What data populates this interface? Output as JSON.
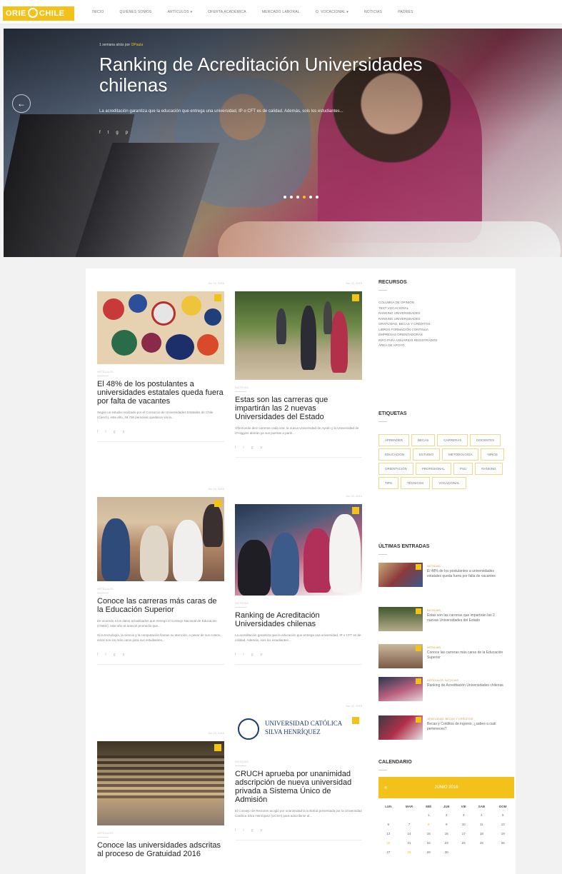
{
  "brand": {
    "logo_left": "ORIE",
    "logo_right": "CHILE",
    "accent": "#f3c21a"
  },
  "menu": [
    "INICIO",
    "QUIÉNES SOMOS",
    "ARTÍCULOS ▾",
    "OFERTA ACADÉMICA",
    "MERCADO LABORAL",
    "O. VOCACIONAL ▾",
    "NOTICIAS",
    "PADRES"
  ],
  "hero": {
    "kicker": "1 semana atrás por",
    "kicker_link": "OPaula",
    "title": "Ranking de Acreditación Universidades chilenas",
    "description": "La acreditación garantiza que la educación que entrega una universidad, IP o CFT es de calidad. Además, sois los estudiantes...",
    "share": [
      "f",
      "t",
      "g",
      "p"
    ],
    "arrow": "←"
  },
  "posts": [
    {
      "date": "Jun 22, 2016",
      "category": "ARTÍCULOS",
      "title": "El 48% de los postulantes a universidades estatales queda fuera por falta de vacantes",
      "excerpt": "Según un estudio realizado por el Consorcio de Universidades Estatales de Chile (Cuech), este año, 48.756 personas quedaron sin la...",
      "share": [
        "f",
        "t",
        "g",
        "p"
      ]
    },
    {
      "date": "Jun 22, 2016",
      "category": "NOTICIAS",
      "title": "Estas son las carreras que impartirán las 2 nuevas Universidades del Estado",
      "excerpt": "Oferecerán diez carreras cada una: la nueva Universidad de Aysén y la Universidad de O'Higgins abrirán ya sus puertas a partir...",
      "share": [
        "f",
        "t",
        "g",
        "p"
      ]
    },
    {
      "date": "Jun 22, 2016",
      "category": "ARTÍCULOS",
      "title": "Conoce las carreras más caras de la Educación Superior",
      "excerpt": "De acuerdo a los datos actualizados que entregó el Consejo Nacional de Educación (CNED), este año el arancel promedio que...",
      "excerpt2": "Si la tecnología, la ciencia y la computación llaman su atención, a pesar de sus costos, estos son los más caros para sus estudiantes...",
      "share": [
        "f",
        "t",
        "g",
        "p"
      ]
    },
    {
      "date": "Jun 22, 2016",
      "category": "NOTICIAS",
      "title": "Ranking de Acreditación Universidades chilenas",
      "excerpt": "La acreditación garantiza que la educación que entrega una universidad, IP o CFT es de calidad. Además, sois los estudiantes...",
      "share": [
        "f",
        "t",
        "g",
        "p"
      ]
    },
    {
      "date": "Jun 22, 2016",
      "category": "ARTÍCULOS",
      "title": "Conoce las universidades adscritas al proceso de Gratuidad 2016",
      "excerpt": "",
      "share": []
    },
    {
      "date": "Jun 22, 2016",
      "category": "NOTICIAS",
      "title": "CRUCH aprueba por unanimidad adscripción de nueva universidad privada a Sistema Único de Admisión",
      "excerpt": "El Consejo de Rectores acogió por unanimidad la solicitud presentada por la Universidad Católica Silva Henríquez (UCSH) para adscribirse al...",
      "share": [
        "f",
        "t",
        "g",
        "p"
      ],
      "logo_line1": "UNIVERSIDAD CATÓLICA",
      "logo_line2": "SILVA HENRÍQUEZ"
    }
  ],
  "sidebar": {
    "resources_title": "RECURSOS",
    "resources": [
      "COLUMNA DE OPINIÓN",
      "TEST VOCACIONAL",
      "RANKING UNIVERSIDADES",
      "RANKING UNIVERSIDADES",
      "GRATUIDAD, BECAS Y CRÉDITOS",
      "LIBROS FORMACIÓN CONTINUA",
      "EMPRESAS ORIENTADORAS",
      "INFO PARA USUARIOS REGISTRADOS",
      "ÁREA DE APOYO"
    ],
    "tags_title": "ETIQUETAS",
    "tags": [
      "APRENDER",
      "BECAS",
      "CARRERAS",
      "DOCENTES",
      "EDUCACIÓN",
      "ESTUDIO",
      "METODOLOGÍA",
      "NIÑOS",
      "ORIENTACIÓN",
      "PROFESIONAL",
      "PSU",
      "RANKING",
      "TIPS",
      "TÉCNICOS",
      "VOCACIONAL"
    ],
    "latest_title": "ÚLTIMAS ENTRADAS",
    "latest": [
      {
        "category": "NOTICIAS",
        "title": "El 48% de los postulantes a universidades estatales queda fuera por falta de vacantes"
      },
      {
        "category": "NOTICIAS",
        "title": "Estas son las carreras que impartirán las 2 nuevas Universidades del Estado"
      },
      {
        "category": "NOTICIAS",
        "title": "Conoce las carreras más caras de la Educación Superior"
      },
      {
        "category": "ARTÍCULOS, NOTICIAS",
        "title": "Ranking de Acreditación Universidades chilenas"
      },
      {
        "category": "GRATUIDAD, BECAS Y CRÉDITOS",
        "title": "Becas y Créditos de ingreso, ¿sabes a cuál perteneces?"
      }
    ],
    "calendar_title": "CALENDARIO",
    "calendar": {
      "month": "JUNIO 2016",
      "prev": "«",
      "days": [
        "LUN",
        "MAR",
        "MIÉ",
        "JUE",
        "VIE",
        "SAB",
        "DOM"
      ],
      "weeks": [
        [
          "",
          "",
          "1",
          "2",
          "3",
          "4",
          "5"
        ],
        [
          "6",
          "7",
          "8",
          "9",
          "10",
          "11",
          "12"
        ],
        [
          "13",
          "14",
          "15",
          "16",
          "17",
          "18",
          "19"
        ],
        [
          "20",
          "21",
          "22",
          "23",
          "24",
          "25",
          "26"
        ],
        [
          "27",
          "28",
          "29",
          "30",
          "",
          "",
          ""
        ]
      ],
      "highlighted": [
        "8",
        "20",
        "28"
      ]
    }
  }
}
